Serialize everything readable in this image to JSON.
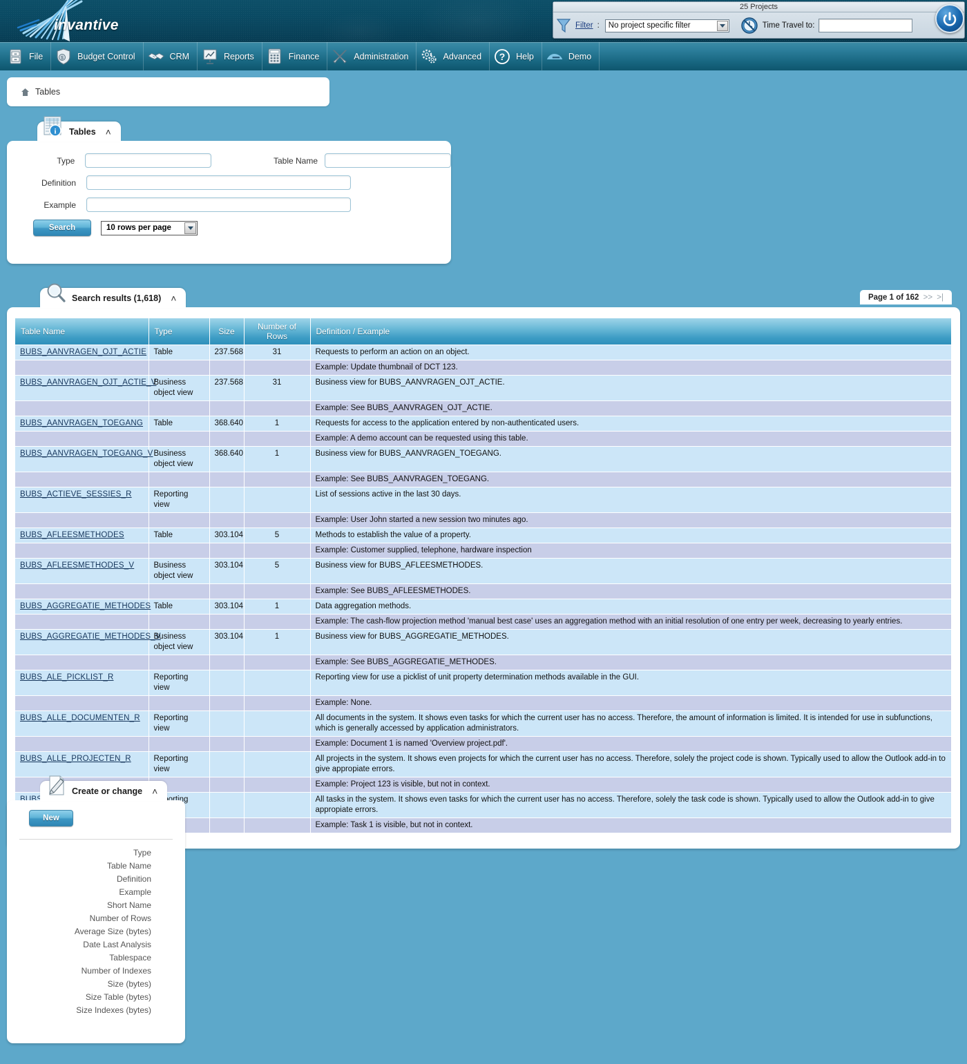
{
  "brand": {
    "name": "invantive",
    "logo_icon": "starburst-logo"
  },
  "topbar": {
    "projects_label": "25 Projects",
    "filter_icon": "funnel-icon",
    "filter_label": "Filter",
    "filter_colon": ":",
    "filter_value": "No project specific filter",
    "clock_icon": "time-travel-clock-icon",
    "time_travel_label": "Time Travel to:",
    "time_travel_value": "",
    "power_icon": "power-logout-icon"
  },
  "menu": {
    "items": [
      {
        "label": "File",
        "icon": "cabinet-icon"
      },
      {
        "label": "Budget Control",
        "icon": "money-shield-icon"
      },
      {
        "label": "CRM",
        "icon": "handshake-icon"
      },
      {
        "label": "Reports",
        "icon": "presentation-chart-icon"
      },
      {
        "label": "Finance",
        "icon": "calculator-icon"
      },
      {
        "label": "Administration",
        "icon": "tools-wrench-icon"
      },
      {
        "label": "Advanced",
        "icon": "gears-icon"
      },
      {
        "label": "Help",
        "icon": "question-mark-icon"
      },
      {
        "label": "Demo",
        "icon": "wave-logo-icon"
      }
    ]
  },
  "breadcrumb": {
    "home_icon": "home-icon",
    "text": "Tables"
  },
  "search_panel": {
    "tab_icon": "table-info-icon",
    "title": "Tables",
    "collapse_icon": "chevron-up-icon",
    "labels": {
      "type": "Type",
      "table_name": "Table Name",
      "definition": "Definition",
      "example": "Example"
    },
    "values": {
      "type": "",
      "table_name": "",
      "definition": "",
      "example": ""
    },
    "placeholders": {
      "type": "",
      "table_name": "",
      "definition": "",
      "example": ""
    },
    "search_button": "Search",
    "rows_per_page": "10 rows per page"
  },
  "results_panel": {
    "tab_icon": "magnifier-icon",
    "title": "Search results (1,618)",
    "collapse_icon": "chevron-up-icon",
    "pager": {
      "label": "Page 1 of 162",
      "next": ">>",
      "last": ">|"
    },
    "columns": [
      "Table Name",
      "Type",
      "Size",
      "Number of Rows",
      "Definition / Example"
    ],
    "rows": [
      {
        "table_name": "BUBS_AANVRAGEN_OJT_ACTIE",
        "type": "Table",
        "size": "237.568",
        "rows": "31",
        "definition": "Requests to perform an action on an object.",
        "example": "Example: Update thumbnail of DCT 123."
      },
      {
        "table_name": "BUBS_AANVRAGEN_OJT_ACTIE_V",
        "type": "Business object view",
        "size": "237.568",
        "rows": "31",
        "definition": "Business view for BUBS_AANVRAGEN_OJT_ACTIE.",
        "example": "Example: See BUBS_AANVRAGEN_OJT_ACTIE."
      },
      {
        "table_name": "BUBS_AANVRAGEN_TOEGANG",
        "type": "Table",
        "size": "368.640",
        "rows": "1",
        "definition": "Requests for access to the application entered by non-authenticated users.",
        "example": "Example: A demo account can be requested using this table."
      },
      {
        "table_name": "BUBS_AANVRAGEN_TOEGANG_V",
        "type": "Business object view",
        "size": "368.640",
        "rows": "1",
        "definition": "Business view for BUBS_AANVRAGEN_TOEGANG.",
        "example": "Example: See BUBS_AANVRAGEN_TOEGANG."
      },
      {
        "table_name": "BUBS_ACTIEVE_SESSIES_R",
        "type": "Reporting view",
        "size": "",
        "rows": "",
        "definition": "List of sessions active in the last 30 days.",
        "example": "Example: User John started a new session two minutes ago."
      },
      {
        "table_name": "BUBS_AFLEESMETHODES",
        "type": "Table",
        "size": "303.104",
        "rows": "5",
        "definition": "Methods to establish the value of a property.",
        "example": "Example: Customer supplied, telephone, hardware inspection"
      },
      {
        "table_name": "BUBS_AFLEESMETHODES_V",
        "type": "Business object view",
        "size": "303.104",
        "rows": "5",
        "definition": "Business view for BUBS_AFLEESMETHODES.",
        "example": "Example: See BUBS_AFLEESMETHODES."
      },
      {
        "table_name": "BUBS_AGGREGATIE_METHODES",
        "type": "Table",
        "size": "303.104",
        "rows": "1",
        "definition": "Data aggregation methods.",
        "example": "Example: The cash-flow projection method 'manual best case' uses an aggregation method with an initial resolution of one entry per week, decreasing to yearly entries."
      },
      {
        "table_name": "BUBS_AGGREGATIE_METHODES_V",
        "type": "Business object view",
        "size": "303.104",
        "rows": "1",
        "definition": "Business view for BUBS_AGGREGATIE_METHODES.",
        "example": "Example: See BUBS_AGGREGATIE_METHODES."
      },
      {
        "table_name": "BUBS_ALE_PICKLIST_R",
        "type": "Reporting view",
        "size": "",
        "rows": "",
        "definition": "Reporting view for use a picklist of unit property determination methods available in the GUI.",
        "example": "Example: None."
      },
      {
        "table_name": "BUBS_ALLE_DOCUMENTEN_R",
        "type": "Reporting view",
        "size": "",
        "rows": "",
        "definition": "All documents in the system. It shows even tasks for which the current user has no access. Therefore, the amount of information is limited. It is intended for use in subfunctions, which is generally accessed by application administrators.",
        "example": "Example: Document 1 is named 'Overview project.pdf'."
      },
      {
        "table_name": "BUBS_ALLE_PROJECTEN_R",
        "type": "Reporting view",
        "size": "",
        "rows": "",
        "definition": "All projects in the system. It shows even projects for which the current user has no access. Therefore, solely the project code is shown. Typically used to allow the Outlook add-in to give appropiate errors.",
        "example": "Example: Project 123 is visible, but not in context."
      },
      {
        "table_name": "BUBS_ALLE_TAKEN_R",
        "type": "Reporting view",
        "size": "",
        "rows": "",
        "definition": "All tasks in the system. It shows even tasks for which the current user has no access. Therefore, solely the task code is shown. Typically used to allow the Outlook add-in to give appropiate errors.",
        "example": "Example: Task 1 is visible, but not in context."
      }
    ]
  },
  "create_panel": {
    "tab_icon": "pencil-document-icon",
    "title": "Create or change",
    "collapse_icon": "chevron-up-icon",
    "new_button": "New",
    "fields": [
      "Type",
      "Table Name",
      "Definition",
      "Example",
      "Short Name",
      "Number of Rows",
      "Average Size (bytes)",
      "Date Last Analysis",
      "Tablespace",
      "Number of Indexes",
      "Size (bytes)",
      "Size Table (bytes)",
      "Size Indexes (bytes)"
    ]
  },
  "colors": {
    "page_background": "#5da8ca",
    "banner_dark": "#0a4a63",
    "menu_teal": "#2c7e9b",
    "table_header": "#3c9cc4",
    "row_main": "#cce6f8",
    "row_example": "#c8cee8",
    "link": "#16365c"
  }
}
